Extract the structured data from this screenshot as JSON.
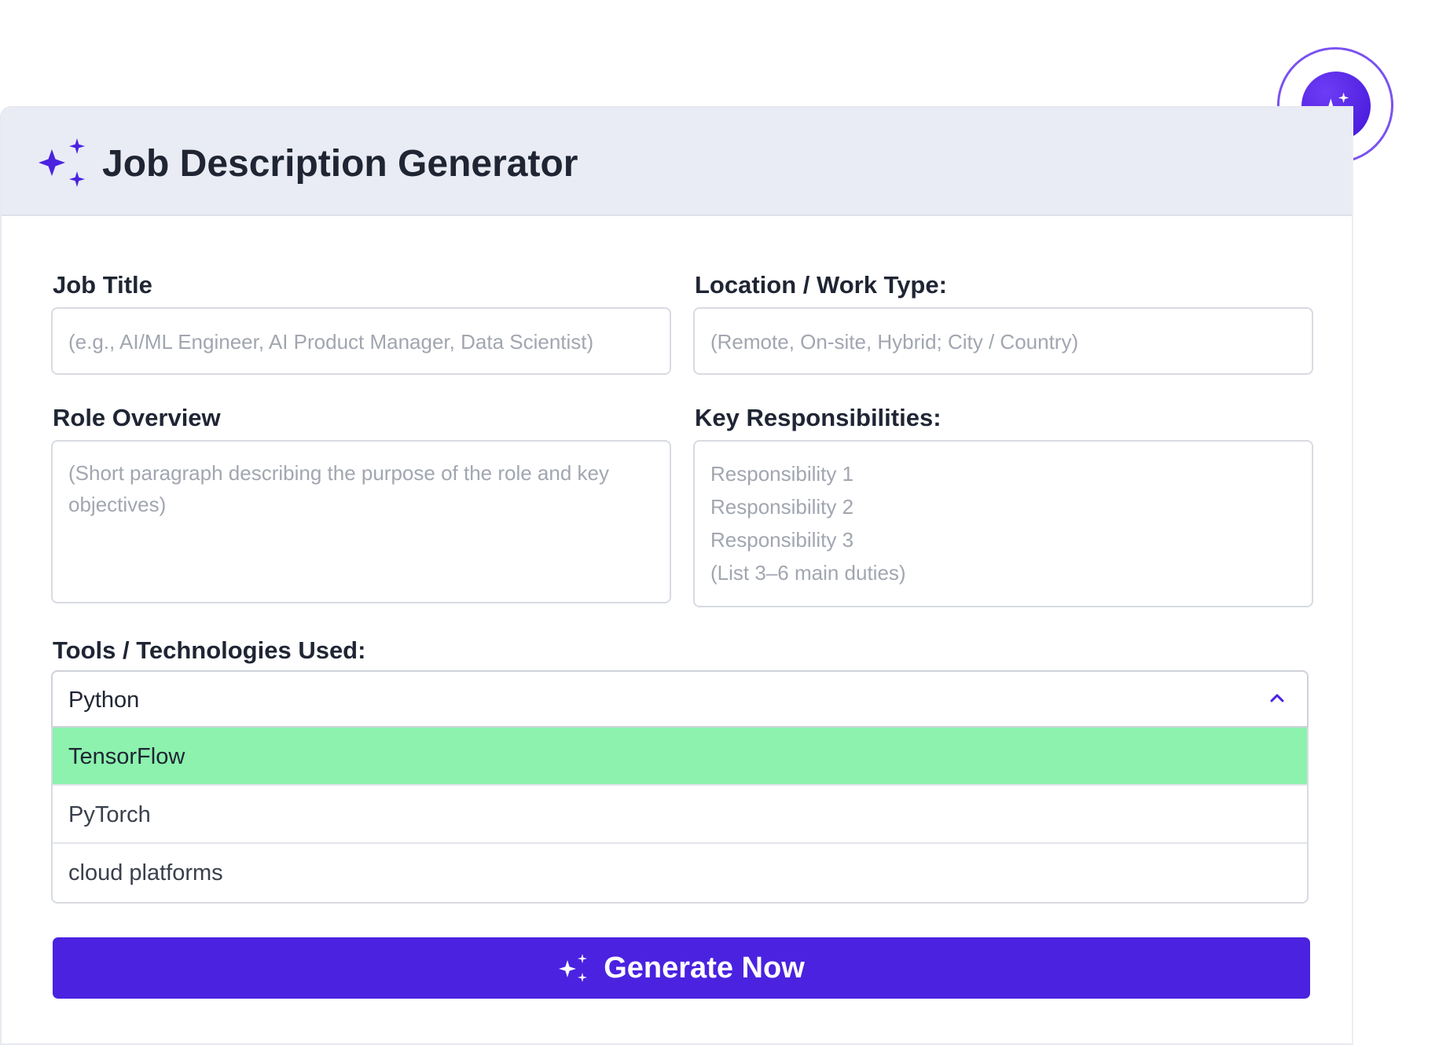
{
  "header": {
    "title": "Job Description Generator",
    "icon": "sparkles-icon"
  },
  "form": {
    "job_title": {
      "label": "Job Title",
      "placeholder": "(e.g., AI/ML Engineer, AI Product Manager, Data Scientist)"
    },
    "location": {
      "label": "Location / Work Type:",
      "placeholder": "(Remote, On-site, Hybrid; City / Country)"
    },
    "role_overview": {
      "label": "Role Overview",
      "placeholder_lines": [
        "(Short paragraph describing the purpose of the role and key",
        "objectives)"
      ]
    },
    "responsibilities": {
      "label": "Key Responsibilities:",
      "placeholder_lines": [
        "Responsibility 1",
        "Responsibility 2",
        "Responsibility 3",
        "(List 3–6 main duties)"
      ]
    },
    "tools": {
      "label": "Tools / Technologies Used:",
      "selected": "Python",
      "options": [
        "TensorFlow",
        "PyTorch",
        "cloud platforms"
      ]
    }
  },
  "actions": {
    "generate_label": "Generate Now"
  },
  "colors": {
    "accent": "#4a22e0",
    "header_bg": "#e9ecf4",
    "highlight": "#8cf2ae"
  }
}
